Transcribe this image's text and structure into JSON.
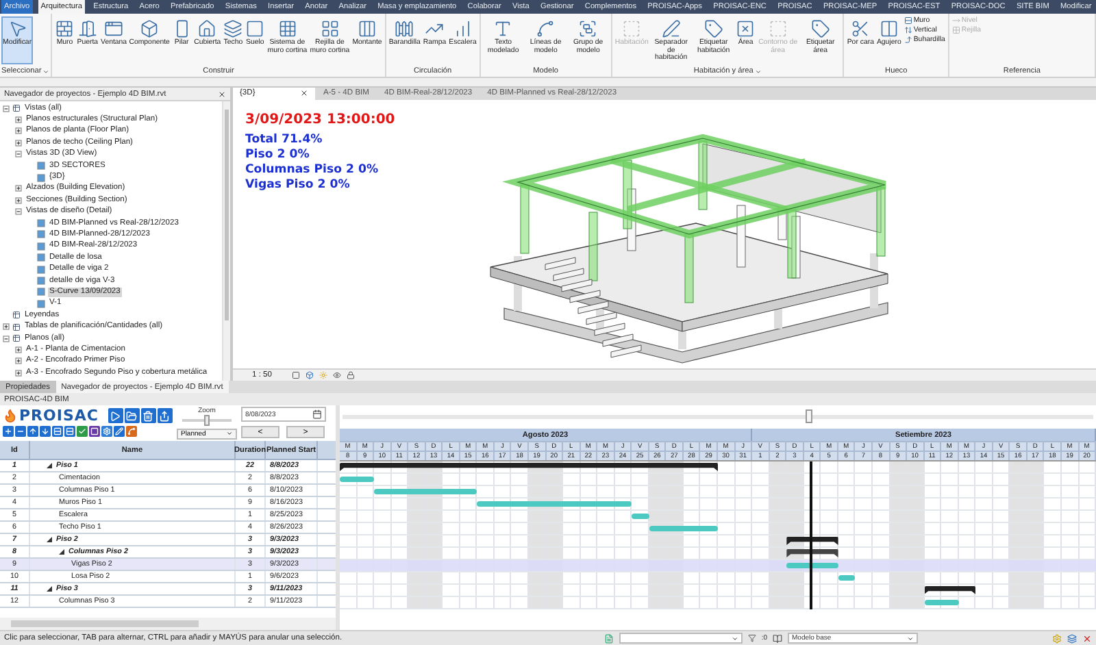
{
  "menu_tabs": [
    {
      "label": "Archivo",
      "selected": false,
      "kind": "file"
    },
    {
      "label": "Arquitectura",
      "selected": true,
      "kind": "tab"
    },
    {
      "label": "Estructura",
      "selected": false,
      "kind": "tab"
    },
    {
      "label": "Acero",
      "selected": false,
      "kind": "tab"
    },
    {
      "label": "Prefabricado",
      "selected": false,
      "kind": "tab"
    },
    {
      "label": "Sistemas",
      "selected": false,
      "kind": "tab"
    },
    {
      "label": "Insertar",
      "selected": false,
      "kind": "tab"
    },
    {
      "label": "Anotar",
      "selected": false,
      "kind": "tab"
    },
    {
      "label": "Analizar",
      "selected": false,
      "kind": "tab"
    },
    {
      "label": "Masa y emplazamiento",
      "selected": false,
      "kind": "tab"
    },
    {
      "label": "Colaborar",
      "selected": false,
      "kind": "tab"
    },
    {
      "label": "Vista",
      "selected": false,
      "kind": "tab"
    },
    {
      "label": "Gestionar",
      "selected": false,
      "kind": "tab"
    },
    {
      "label": "Complementos",
      "selected": false,
      "kind": "tab"
    },
    {
      "label": "PROISAC-Apps",
      "selected": false,
      "kind": "tab"
    },
    {
      "label": "PROISAC-ENC",
      "selected": false,
      "kind": "tab"
    },
    {
      "label": "PROISAC",
      "selected": false,
      "kind": "tab"
    },
    {
      "label": "PROISAC-MEP",
      "selected": false,
      "kind": "tab"
    },
    {
      "label": "PROISAC-EST",
      "selected": false,
      "kind": "tab"
    },
    {
      "label": "PROISAC-DOC",
      "selected": false,
      "kind": "tab"
    },
    {
      "label": "SITE BIM",
      "selected": false,
      "kind": "tab"
    },
    {
      "label": "Modificar",
      "selected": false,
      "kind": "tab"
    }
  ],
  "ribbon": {
    "groups": [
      {
        "label": "Seleccionar",
        "has_menu": true,
        "tools": [
          {
            "label": "Modificar",
            "kind": "large",
            "selected": true,
            "disabled": false
          }
        ]
      },
      {
        "label": "Construir",
        "has_menu": false,
        "tools": [
          {
            "label": "Muro",
            "kind": "large",
            "selected": false,
            "disabled": false
          },
          {
            "label": "Puerta",
            "kind": "large",
            "selected": false,
            "disabled": false
          },
          {
            "label": "Ventana",
            "kind": "large",
            "selected": false,
            "disabled": false
          },
          {
            "label": "Componente",
            "kind": "large",
            "selected": false,
            "disabled": false
          },
          {
            "label": "Pilar",
            "kind": "large",
            "selected": false,
            "disabled": false
          },
          {
            "label": "Cubierta",
            "kind": "large",
            "selected": false,
            "disabled": false
          },
          {
            "label": "Techo",
            "kind": "large",
            "selected": false,
            "disabled": false
          },
          {
            "label": "Suelo",
            "kind": "large",
            "selected": false,
            "disabled": false
          },
          {
            "label": "Sistema de muro cortina",
            "kind": "large",
            "selected": false,
            "disabled": false
          },
          {
            "label": "Rejilla de muro cortina",
            "kind": "large",
            "selected": false,
            "disabled": false
          },
          {
            "label": "Montante",
            "kind": "large",
            "selected": false,
            "disabled": false
          }
        ]
      },
      {
        "label": "Circulación",
        "has_menu": false,
        "tools": [
          {
            "label": "Barandilla",
            "kind": "large",
            "selected": false,
            "disabled": false
          },
          {
            "label": "Rampa",
            "kind": "large",
            "selected": false,
            "disabled": false
          },
          {
            "label": "Escalera",
            "kind": "large",
            "selected": false,
            "disabled": false
          }
        ]
      },
      {
        "label": "Modelo",
        "has_menu": false,
        "tools": [
          {
            "label": "Texto modelado",
            "kind": "large",
            "selected": false,
            "disabled": false
          },
          {
            "label": "Líneas de modelo",
            "kind": "large",
            "selected": false,
            "disabled": false
          },
          {
            "label": "Grupo de modelo",
            "kind": "large",
            "selected": false,
            "disabled": false
          }
        ]
      },
      {
        "label": "Habitación y área",
        "has_menu": true,
        "tools": [
          {
            "label": "Habitación",
            "kind": "large",
            "selected": false,
            "disabled": true
          },
          {
            "label": "Separador de habitación",
            "kind": "large",
            "selected": false,
            "disabled": false
          },
          {
            "label": "Etiquetar habitación",
            "kind": "large",
            "selected": false,
            "disabled": false
          },
          {
            "label": "Área",
            "kind": "large",
            "selected": false,
            "disabled": false
          },
          {
            "label": "Contorno de área",
            "kind": "large",
            "selected": false,
            "disabled": true
          },
          {
            "label": "Etiquetar área",
            "kind": "large",
            "selected": false,
            "disabled": false
          }
        ]
      },
      {
        "label": "Hueco",
        "has_menu": false,
        "tools": [
          {
            "label": "Por cara",
            "kind": "large",
            "selected": false,
            "disabled": false
          },
          {
            "label": "Agujero",
            "kind": "large",
            "selected": false,
            "disabled": false
          },
          {
            "label": "Muro",
            "kind": "small",
            "selected": false,
            "disabled": false
          },
          {
            "label": "Vertical",
            "kind": "small",
            "selected": false,
            "disabled": false
          },
          {
            "label": "Buhardilla",
            "kind": "small",
            "selected": false,
            "disabled": false
          }
        ]
      },
      {
        "label": "Referencia",
        "has_menu": false,
        "tools": [
          {
            "label": "Nivel",
            "kind": "small",
            "selected": false,
            "disabled": true
          },
          {
            "label": "Rejilla",
            "kind": "small",
            "selected": false,
            "disabled": true
          }
        ]
      }
    ]
  },
  "project_browser": {
    "title": "Navegador de proyectos - Ejemplo 4D BIM.rvt",
    "items": [
      {
        "label": "Vistas (all)",
        "expanded": true,
        "selected": false,
        "children": [
          {
            "label": "Planos estructurales (Structural Plan)",
            "expanded": false,
            "selected": false
          },
          {
            "label": "Planos de planta (Floor Plan)",
            "expanded": false,
            "selected": false
          },
          {
            "label": "Planos de techo (Ceiling Plan)",
            "expanded": false,
            "selected": false
          },
          {
            "label": "Vistas 3D (3D View)",
            "expanded": true,
            "selected": false,
            "children": [
              {
                "label": "3D SECTORES",
                "selected": false
              },
              {
                "label": "{3D}",
                "selected": false
              }
            ]
          },
          {
            "label": "Alzados (Building Elevation)",
            "expanded": false,
            "selected": false
          },
          {
            "label": "Secciones (Building Section)",
            "expanded": false,
            "selected": false
          },
          {
            "label": "Vistas de diseño (Detail)",
            "expanded": true,
            "selected": false,
            "children": [
              {
                "label": "4D BIM-Planned vs Real-28/12/2023",
                "selected": false
              },
              {
                "label": "4D BIM-Planned-28/12/2023",
                "selected": false
              },
              {
                "label": "4D BIM-Real-28/12/2023",
                "selected": false
              },
              {
                "label": "Detalle de losa",
                "selected": false
              },
              {
                "label": "Detalle de viga 2",
                "selected": false
              },
              {
                "label": "detalle de viga V-3",
                "selected": false
              },
              {
                "label": "S-Curve 13/09/2023",
                "selected": true
              },
              {
                "label": "V-1",
                "selected": false
              }
            ]
          }
        ]
      },
      {
        "label": "Leyendas",
        "selected": false
      },
      {
        "label": "Tablas de planificación/Cantidades (all)",
        "expanded": false,
        "selected": false
      },
      {
        "label": "Planos (all)",
        "expanded": true,
        "selected": false,
        "children": [
          {
            "label": "A-1 - Planta de Cimentacion",
            "expanded": false,
            "selected": false
          },
          {
            "label": "A-2 - Encofrado Primer Piso",
            "expanded": false,
            "selected": false
          },
          {
            "label": "A-3 - Encofrado Segundo Piso y cobertura metálica",
            "expanded": false,
            "selected": false
          }
        ]
      }
    ]
  },
  "view": {
    "tabs": [
      {
        "label": "{3D}",
        "selected": true
      },
      {
        "label": "A-5 - 4D BIM",
        "selected": false
      },
      {
        "label": "4D BIM-Real-28/12/2023",
        "selected": false
      },
      {
        "label": "4D BIM-Planned vs Real-28/12/2023",
        "selected": false
      }
    ],
    "date": "3/09/2023 13:00:00",
    "progress_lines": [
      "Total 71.4%",
      "Piso 2 0%",
      "Columnas Piso 2 0%",
      "Vigas Piso 2 0%"
    ],
    "scale": "1 : 50"
  },
  "panel_tabs": [
    {
      "label": "Propiedades",
      "selected": false
    },
    {
      "label": "Navegador de proyectos - Ejemplo 4D BIM.rvt",
      "selected": true
    }
  ],
  "schedule": {
    "title": "PROISAC-4D BIM",
    "logo": "PROISAC",
    "zoom": {
      "label": "Zoom",
      "level": 0.5
    },
    "timeline": {
      "level": 0.62
    },
    "date": "8/08/2023",
    "mode": "Planned",
    "prev": "<",
    "next": ">",
    "columns": [
      "Id",
      "Name",
      "Duration",
      "Planned Start"
    ],
    "rows": [
      {
        "id": "1",
        "name": "Piso 1",
        "duration": "22",
        "planned_start": "8/8/2023",
        "kind": "summary",
        "expanded": true,
        "selected": false,
        "children": [
          {
            "id": "2",
            "name": "Cimentacion",
            "duration": "2",
            "planned_start": "8/8/2023",
            "kind": "task",
            "selected": false
          },
          {
            "id": "3",
            "name": "Columnas Piso 1",
            "duration": "6",
            "planned_start": "8/10/2023",
            "kind": "task",
            "selected": false
          },
          {
            "id": "4",
            "name": "Muros Piso 1",
            "duration": "9",
            "planned_start": "8/16/2023",
            "kind": "task",
            "selected": false
          },
          {
            "id": "5",
            "name": "Escalera",
            "duration": "1",
            "planned_start": "8/25/2023",
            "kind": "task",
            "selected": false
          },
          {
            "id": "6",
            "name": "Techo Piso 1",
            "duration": "4",
            "planned_start": "8/26/2023",
            "kind": "task",
            "selected": false
          }
        ]
      },
      {
        "id": "7",
        "name": "Piso 2",
        "duration": "3",
        "planned_start": "9/3/2023",
        "kind": "summary",
        "expanded": true,
        "selected": false,
        "children": [
          {
            "id": "8",
            "name": "Columnas Piso 2",
            "duration": "3",
            "planned_start": "9/3/2023",
            "kind": "summary",
            "expanded": true,
            "selected": false,
            "children": [
              {
                "id": "9",
                "name": "Vigas Piso 2",
                "duration": "3",
                "planned_start": "9/3/2023",
                "kind": "task",
                "selected": true
              },
              {
                "id": "10",
                "name": "Losa Piso 2",
                "duration": "1",
                "planned_start": "9/6/2023",
                "kind": "task",
                "selected": false
              }
            ]
          }
        ]
      },
      {
        "id": "11",
        "name": "Piso 3",
        "duration": "3",
        "planned_start": "9/11/2023",
        "kind": "summary",
        "expanded": true,
        "selected": false,
        "children": [
          {
            "id": "12",
            "name": "Columnas Piso 3",
            "duration": "2",
            "planned_start": "9/11/2023",
            "kind": "task",
            "selected": false
          }
        ]
      }
    ],
    "months": [
      {
        "label": "Agosto 2023",
        "days": [
          {
            "letter": "M",
            "number": "8",
            "weekend": false
          },
          {
            "letter": "M",
            "number": "9",
            "weekend": false
          },
          {
            "letter": "J",
            "number": "10",
            "weekend": false
          },
          {
            "letter": "V",
            "number": "11",
            "weekend": false
          },
          {
            "letter": "S",
            "number": "12",
            "weekend": true
          },
          {
            "letter": "D",
            "number": "13",
            "weekend": true
          },
          {
            "letter": "L",
            "number": "14",
            "weekend": false
          },
          {
            "letter": "M",
            "number": "15",
            "weekend": false
          },
          {
            "letter": "M",
            "number": "16",
            "weekend": false
          },
          {
            "letter": "J",
            "number": "17",
            "weekend": false
          },
          {
            "letter": "V",
            "number": "18",
            "weekend": false
          },
          {
            "letter": "S",
            "number": "19",
            "weekend": true
          },
          {
            "letter": "D",
            "number": "20",
            "weekend": true
          },
          {
            "letter": "L",
            "number": "21",
            "weekend": false
          },
          {
            "letter": "M",
            "number": "22",
            "weekend": false
          },
          {
            "letter": "M",
            "number": "23",
            "weekend": false
          },
          {
            "letter": "J",
            "number": "24",
            "weekend": false
          },
          {
            "letter": "V",
            "number": "25",
            "weekend": false
          },
          {
            "letter": "S",
            "number": "26",
            "weekend": true
          },
          {
            "letter": "D",
            "number": "27",
            "weekend": true
          },
          {
            "letter": "L",
            "number": "28",
            "weekend": false
          },
          {
            "letter": "M",
            "number": "29",
            "weekend": false
          },
          {
            "letter": "M",
            "number": "30",
            "weekend": false
          },
          {
            "letter": "J",
            "number": "31",
            "weekend": false
          }
        ]
      },
      {
        "label": "Setiembre 2023",
        "days": [
          {
            "letter": "V",
            "number": "1",
            "weekend": false
          },
          {
            "letter": "S",
            "number": "2",
            "weekend": true
          },
          {
            "letter": "D",
            "number": "3",
            "weekend": true
          },
          {
            "letter": "L",
            "number": "4",
            "weekend": false,
            "today": true
          },
          {
            "letter": "M",
            "number": "5",
            "weekend": false
          },
          {
            "letter": "M",
            "number": "6",
            "weekend": false
          },
          {
            "letter": "J",
            "number": "7",
            "weekend": false
          },
          {
            "letter": "V",
            "number": "8",
            "weekend": false
          },
          {
            "letter": "S",
            "number": "9",
            "weekend": true
          },
          {
            "letter": "D",
            "number": "10",
            "weekend": true
          },
          {
            "letter": "L",
            "number": "11",
            "weekend": false
          },
          {
            "letter": "M",
            "number": "12",
            "weekend": false
          },
          {
            "letter": "M",
            "number": "13",
            "weekend": false
          },
          {
            "letter": "J",
            "number": "14",
            "weekend": false
          },
          {
            "letter": "V",
            "number": "15",
            "weekend": false
          },
          {
            "letter": "S",
            "number": "16",
            "weekend": true
          },
          {
            "letter": "D",
            "number": "17",
            "weekend": true
          },
          {
            "letter": "L",
            "number": "18",
            "weekend": false
          },
          {
            "letter": "M",
            "number": "19",
            "weekend": false
          },
          {
            "letter": "M",
            "number": "20",
            "weekend": false
          }
        ]
      }
    ]
  },
  "status_bar": {
    "message": "Clic para seleccionar, TAB para alternar, CTRL para añadir y MAYÚS para anular una selección.",
    "selection_count": ":0",
    "model": "Modelo base"
  }
}
